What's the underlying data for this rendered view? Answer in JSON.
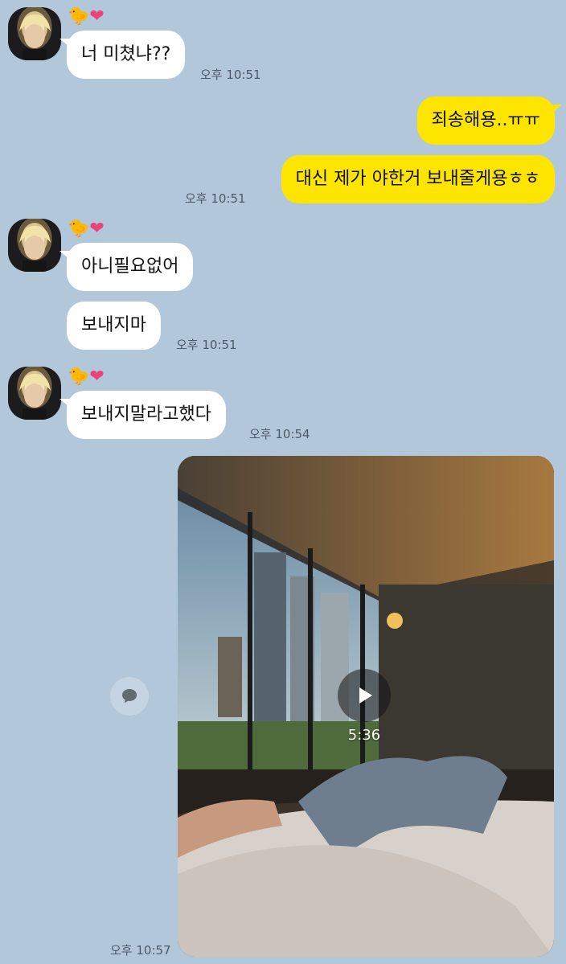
{
  "sender": {
    "name_emoji_chick": "🐤",
    "name_emoji_heart": "❤"
  },
  "messages": {
    "m1": {
      "text": "너 미쳤냐??",
      "time": "오후 10:51"
    },
    "m2": {
      "text": "죄송해용..ㅠㅠ"
    },
    "m3": {
      "text": "대신 제가 야한거 보내줄게용ㅎㅎ",
      "time": "오후 10:51"
    },
    "m4": {
      "text": "아니필요없어"
    },
    "m5": {
      "text": "보내지마",
      "time": "오후 10:51"
    },
    "m6": {
      "text": "보내지말라고했다",
      "time": "오후 10:54"
    },
    "video": {
      "duration": "5:36",
      "time": "오후 10:57"
    }
  },
  "colors": {
    "background": "#b2c7da",
    "incoming_bubble": "#ffffff",
    "outgoing_bubble": "#fee500"
  },
  "icons": {
    "share": "speech-bubble-icon",
    "play": "play-icon"
  }
}
